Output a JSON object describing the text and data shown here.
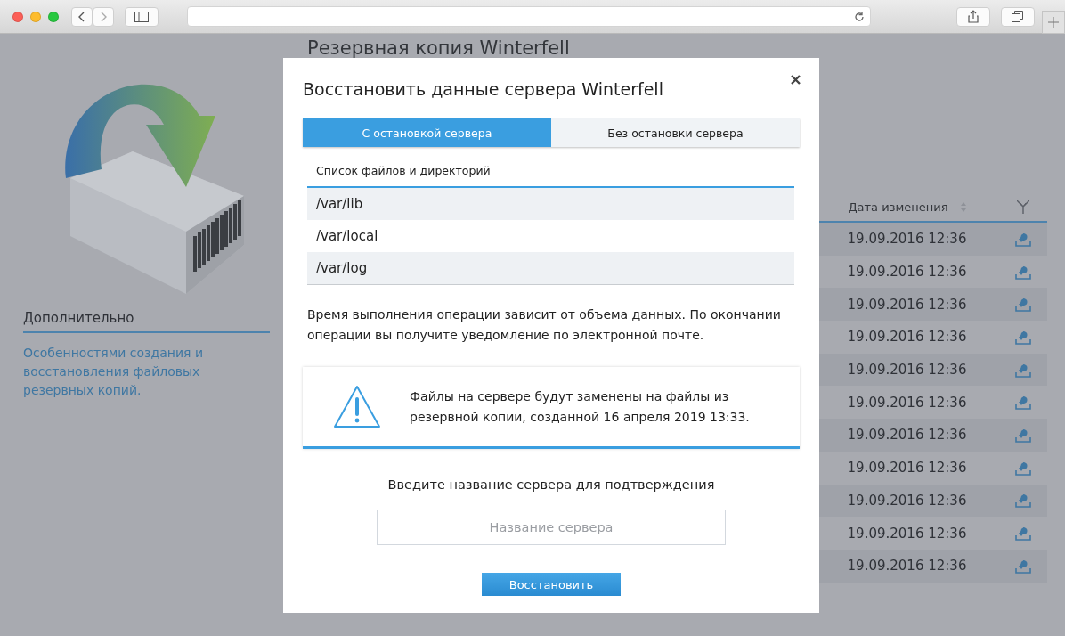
{
  "page": {
    "title": "Резервная копия Winterfell"
  },
  "sidebar": {
    "heading": "Дополнительно",
    "link": "Особенностями создания и восстановления файловых резервных копий."
  },
  "table": {
    "columns": [
      {
        "label": "Дата изменения"
      }
    ],
    "rows": [
      {
        "date": "19.09.2016 12:36"
      },
      {
        "date": "19.09.2016 12:36"
      },
      {
        "date": "19.09.2016 12:36"
      },
      {
        "date": "19.09.2016 12:36"
      },
      {
        "date": "19.09.2016 12:36"
      },
      {
        "date": "19.09.2016 12:36"
      },
      {
        "date": "19.09.2016 12:36"
      },
      {
        "date": "19.09.2016 12:36"
      },
      {
        "date": "19.09.2016 12:36"
      },
      {
        "date": "19.09.2016 12:36"
      },
      {
        "date": "19.09.2016 12:36"
      }
    ]
  },
  "modal": {
    "title": "Восстановить данные сервера Winterfell",
    "tabs": [
      {
        "label": "С остановкой сервера",
        "selected": true
      },
      {
        "label": "Без остановки сервера",
        "selected": false
      }
    ],
    "list_label": "Список файлов и директорий",
    "paths": [
      "/var/lib",
      "/var/local",
      "/var/log"
    ],
    "note": "Время выполнения операции зависит от объема данных. По окончании операции вы получите уведомление по электронной почте.",
    "warning": "Файлы на сервере будут заменены на файлы из резервной копии, созданной 16 апреля 2019 13:33.",
    "confirm_label": "Введите название сервера для подтверждения",
    "input": {
      "placeholder": "Название сервера"
    },
    "submit": "Восстановить"
  }
}
